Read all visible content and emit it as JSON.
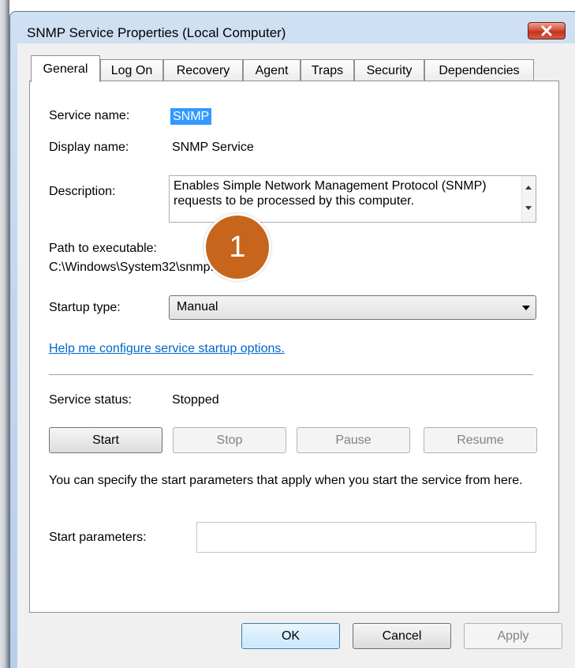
{
  "window": {
    "title": "SNMP Service Properties (Local Computer)",
    "close_icon": "close-icon"
  },
  "tabs": [
    {
      "label": "General",
      "active": true
    },
    {
      "label": "Log On"
    },
    {
      "label": "Recovery"
    },
    {
      "label": "Agent"
    },
    {
      "label": "Traps"
    },
    {
      "label": "Security"
    },
    {
      "label": "Dependencies"
    }
  ],
  "general": {
    "service_name_label": "Service name:",
    "service_name_value": "SNMP",
    "display_name_label": "Display name:",
    "display_name_value": "SNMP Service",
    "description_label": "Description:",
    "description_value": "Enables Simple Network Management Protocol (SNMP) requests to be processed by this computer.",
    "path_label": "Path to executable:",
    "path_value": "C:\\Windows\\System32\\snmp.exe",
    "startup_type_label": "Startup type:",
    "startup_type_value": "Manual",
    "help_link": "Help me configure service startup options.",
    "service_status_label": "Service status:",
    "service_status_value": "Stopped",
    "buttons": {
      "start": "Start",
      "stop": "Stop",
      "pause": "Pause",
      "resume": "Resume"
    },
    "note": "You can specify the start parameters that apply when you start the service from here.",
    "start_parameters_label": "Start parameters:",
    "start_parameters_value": ""
  },
  "annotation": {
    "badge_number": "1",
    "color": "#c8651c"
  },
  "footer": {
    "ok": "OK",
    "cancel": "Cancel",
    "apply": "Apply"
  }
}
